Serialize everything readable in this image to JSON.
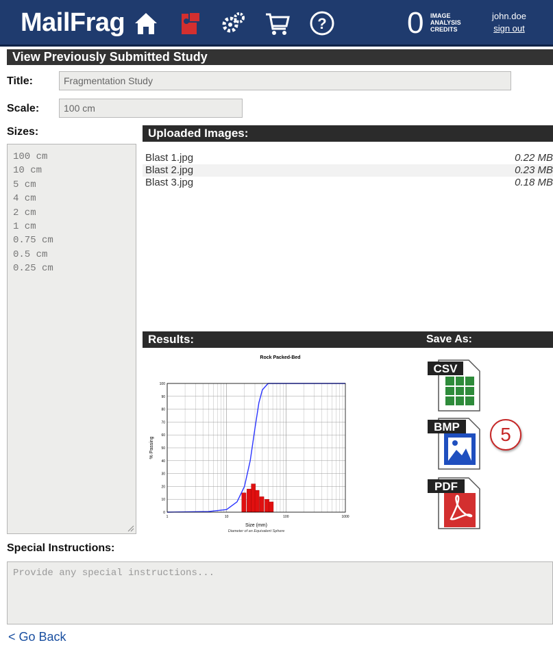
{
  "header": {
    "logo": "MailFrag",
    "credits_count": "0",
    "credits_label": [
      "IMAGE",
      "ANALYSIS",
      "CREDITS"
    ],
    "username": "john.doe",
    "signout_label": "sign out",
    "nav_icons": [
      "home-icon",
      "new-study-icon",
      "settings-icon",
      "cart-icon",
      "help-icon"
    ],
    "colors": {
      "bar": "#1f3b6e",
      "accent_red": "#d32f2f"
    }
  },
  "section_title": "View Previously Submitted Study",
  "form": {
    "title_label": "Title:",
    "title_value": "Fragmentation Study",
    "scale_label": "Scale:",
    "scale_value": "100 cm",
    "sizes_label": "Sizes:",
    "sizes": [
      "100 cm",
      "10 cm",
      "5 cm",
      "4 cm",
      "2 cm",
      "1 cm",
      "0.75 cm",
      "0.5 cm",
      "0.25 cm"
    ]
  },
  "uploaded": {
    "heading": "Uploaded Images:",
    "files": [
      {
        "name": "Blast 1.jpg",
        "size": "0.22 MB"
      },
      {
        "name": "Blast 2.jpg",
        "size": "0.23 MB"
      },
      {
        "name": "Blast 3.jpg",
        "size": "0.18 MB"
      }
    ]
  },
  "results": {
    "heading": "Results:",
    "save_as_label": "Save As:",
    "formats": [
      {
        "label": "CSV",
        "icon": "csv-file-icon",
        "color": "#2e8b3a"
      },
      {
        "label": "BMP",
        "icon": "bmp-file-icon",
        "color": "#1f4fbf"
      },
      {
        "label": "PDF",
        "icon": "pdf-file-icon",
        "color": "#d32f2f"
      }
    ],
    "step_badge": "5"
  },
  "chart_data": {
    "type": "line",
    "title": "Rock Packed-Bed",
    "xlabel": "Size (mm)",
    "xlabel_sub": "Diameter of an Equivalent Sphere",
    "ylabel": "% Passing",
    "xscale": "log",
    "xlim": [
      1,
      1000
    ],
    "ylim": [
      0,
      100
    ],
    "x_ticks": [
      "1",
      "10",
      "100",
      "1000"
    ],
    "y_ticks": [
      "0",
      "10",
      "20",
      "30",
      "40",
      "50",
      "60",
      "70",
      "80",
      "90",
      "100"
    ],
    "series": [
      {
        "x": [
          1,
          5,
          10,
          15,
          20,
          25,
          30,
          35,
          40,
          50,
          1000
        ],
        "y": [
          0,
          0.5,
          2,
          8,
          20,
          40,
          65,
          85,
          95,
          100,
          100
        ]
      }
    ],
    "histogram": {
      "x": [
        18,
        22,
        26,
        30,
        36,
        44,
        52
      ],
      "y": [
        15,
        18,
        22,
        17,
        12,
        10,
        8
      ]
    },
    "grid": true
  },
  "special": {
    "label": "Special Instructions:",
    "placeholder": "Provide any special instructions..."
  },
  "go_back": "< Go Back"
}
